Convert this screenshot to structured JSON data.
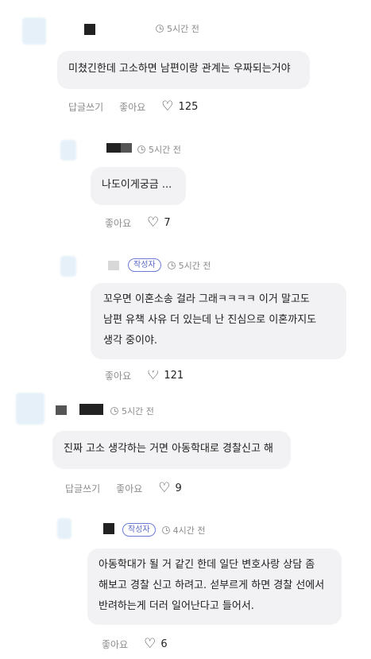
{
  "comments": [
    {
      "time": "5시간 전",
      "text": "미쳤긴한데 고소하면 남편이랑 관계는 우짜되는거야",
      "reply_label": "답글쓰기",
      "like_label": "좋아요",
      "like_count": "125"
    },
    {
      "time": "5시간 전",
      "text": "나도이게궁금 ...",
      "like_label": "좋아요",
      "like_count": "7"
    },
    {
      "badge": "작성자",
      "time": "5시간 전",
      "lines": [
        "꼬우면 이혼소송 걸라 그래ㅋㅋㅋㅋ 이거 말고도",
        "남편 유책 사유 더 있는데 난 진심으로 이혼까지도",
        "생각 중이야."
      ],
      "like_label": "좋아요",
      "like_count": "121"
    },
    {
      "time": "5시간 전",
      "text": "진짜 고소 생각하는 거면 아동학대로 경찰신고 해",
      "reply_label": "답글쓰기",
      "like_label": "좋아요",
      "like_count": "9"
    },
    {
      "badge": "작성자",
      "time": "4시간 전",
      "lines": [
        "아동학대가 될 거 같긴 한데 일단 변호사랑 상담 좀",
        "해보고 경찰 신고 하려고. 섣부르게 하면 경찰 선에서",
        "반려하는게 더러 일어난다고 들어서."
      ],
      "like_label": "좋아요",
      "like_count": "6"
    }
  ],
  "icons": {
    "like": "heart-outline-icon",
    "time": "clock-icon"
  },
  "colors": {
    "bubble": "#f2f2f4",
    "badge": "#6c7bd6",
    "meta": "#8a8a8a"
  }
}
